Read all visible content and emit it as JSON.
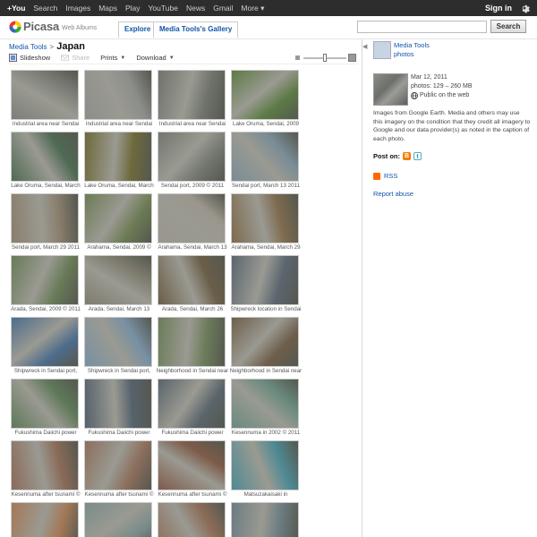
{
  "gbar": {
    "links": [
      "+You",
      "Search",
      "Images",
      "Maps",
      "Play",
      "YouTube",
      "News",
      "Gmail",
      "More ▾"
    ],
    "signin": "Sign in",
    "settings_icon": "gear-icon"
  },
  "header": {
    "logo_text": "Picasa",
    "logo_sub": "Web Albums",
    "tab_explore": "Explore",
    "tab_gallery": "Media Tools's Gallery",
    "search_placeholder": "",
    "search_button": "Search"
  },
  "breadcrumb": {
    "parent": "Media Tools",
    "separator": ">",
    "title": "Japan"
  },
  "toolbar": {
    "slideshow": "Slideshow",
    "share": "Share",
    "prints": "Prints",
    "download": "Download",
    "zoom_level": 0.5
  },
  "photos": [
    {
      "caption": "Industrial area near Sendai",
      "color": "#7d7e78"
    },
    {
      "caption": "Industrial area near Sendai",
      "color": "#8c8e8a"
    },
    {
      "caption": "Industrial area near Sendai",
      "color": "#6f736c"
    },
    {
      "caption": "Lake Oruma, Sendai, 2009",
      "color": "#5d7a45"
    },
    {
      "caption": "Lake Oruma, Sendai, March",
      "color": "#4f6a54"
    },
    {
      "caption": "Lake Oruma, Sendai, March",
      "color": "#6e6a3c"
    },
    {
      "caption": "Sendai port, 2009 © 2011",
      "color": "#72766e"
    },
    {
      "caption": "Sendai port, March 13 2011",
      "color": "#7a8c96"
    },
    {
      "caption": "Sendai port, March 29 2011",
      "color": "#8a7e6c"
    },
    {
      "caption": "Arahama, Sendai, 2009 ©",
      "color": "#6c7b55"
    },
    {
      "caption": "Arahama, Sendai, March 13",
      "color": "#9a968c"
    },
    {
      "caption": "Arahama, Sendai, March 29",
      "color": "#7e6a4e"
    },
    {
      "caption": "Arada, Sendai, 2009 © 2011",
      "color": "#687a58"
    },
    {
      "caption": "Arada, Sendai, March 13",
      "color": "#7e7c6e"
    },
    {
      "caption": "Arada, Sendai, March 26",
      "color": "#6a5e48"
    },
    {
      "caption": "Shipwreck location in Sendai",
      "color": "#5c6670"
    },
    {
      "caption": "Shipwreck in Sendai port,",
      "color": "#4e6c8c"
    },
    {
      "caption": "Shipwreck in Sendai port,",
      "color": "#7890a4"
    },
    {
      "caption": "Neighborhood in Sendai near",
      "color": "#6c7c5a"
    },
    {
      "caption": "Neighborhood in Sendai near",
      "color": "#6e5e4c"
    },
    {
      "caption": "Fukushima Daiichi power",
      "color": "#5e7858"
    },
    {
      "caption": "Fukushima Daiichi power",
      "color": "#56626c"
    },
    {
      "caption": "Fukushima Daiichi power",
      "color": "#5a646a"
    },
    {
      "caption": "Kesennuma in 2002 © 2011",
      "color": "#6a8a7e"
    },
    {
      "caption": "Kesennuma after tsunami ©",
      "color": "#8a6a58"
    },
    {
      "caption": "Kesennuma after tsunami ©",
      "color": "#8c6e5c"
    },
    {
      "caption": "Kesennuma after tsunami ©",
      "color": "#7e5a48"
    },
    {
      "caption": "Matsuzakaisaki in",
      "color": "#4e8a94"
    },
    {
      "caption": "",
      "color": "#a47858"
    },
    {
      "caption": "",
      "color": "#7a8c8a"
    },
    {
      "caption": "",
      "color": "#8c6c58"
    },
    {
      "caption": "",
      "color": "#6c7c82"
    }
  ],
  "sidebar": {
    "owner_name": "Media Tools",
    "owner_sub": "photos",
    "date": "Mar 12, 2011",
    "count": "photos: 129 – 260 MB",
    "visibility": "Public on the web",
    "description": "Images from Google Earth. Media and others may use this imagery on the condition that they credit all imagery to Google and our data provider(s) as noted in the caption of each photo.",
    "post_on": "Post on:",
    "rss": "RSS",
    "report": "Report abuse"
  }
}
